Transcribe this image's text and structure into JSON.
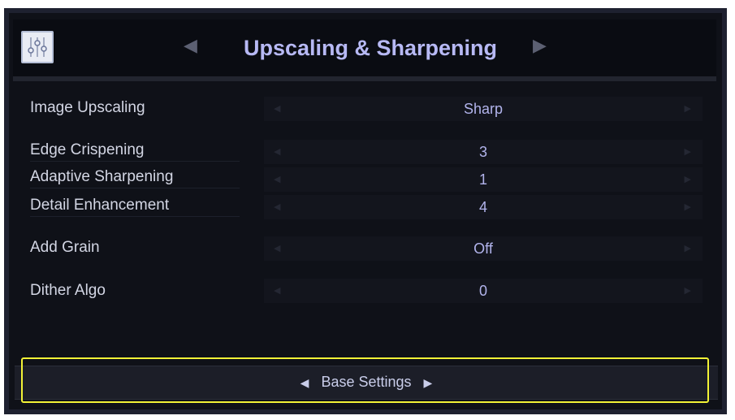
{
  "header": {
    "title": "Upscaling & Sharpening",
    "prev_arrow": "◀",
    "next_arrow": "▶",
    "settings_icon": "sliders-icon"
  },
  "settings": [
    {
      "label": "Image Upscaling",
      "value": "Sharp"
    },
    {
      "label": "Edge Crispening",
      "value": "3"
    },
    {
      "label": "Adaptive Sharpening",
      "value": "1"
    },
    {
      "label": "Detail Enhancement",
      "value": "4"
    },
    {
      "label": "Add Grain",
      "value": "Off"
    },
    {
      "label": "Dither Algo",
      "value": "0"
    }
  ],
  "value_arrows": {
    "left": "◀",
    "right": "▶"
  },
  "footer": {
    "label": "Base Settings",
    "prev_arrow": "◀",
    "next_arrow": "▶"
  },
  "colors": {
    "accent": "#b7b9f4",
    "highlight": "#f2f236",
    "background": "#0f1118"
  }
}
